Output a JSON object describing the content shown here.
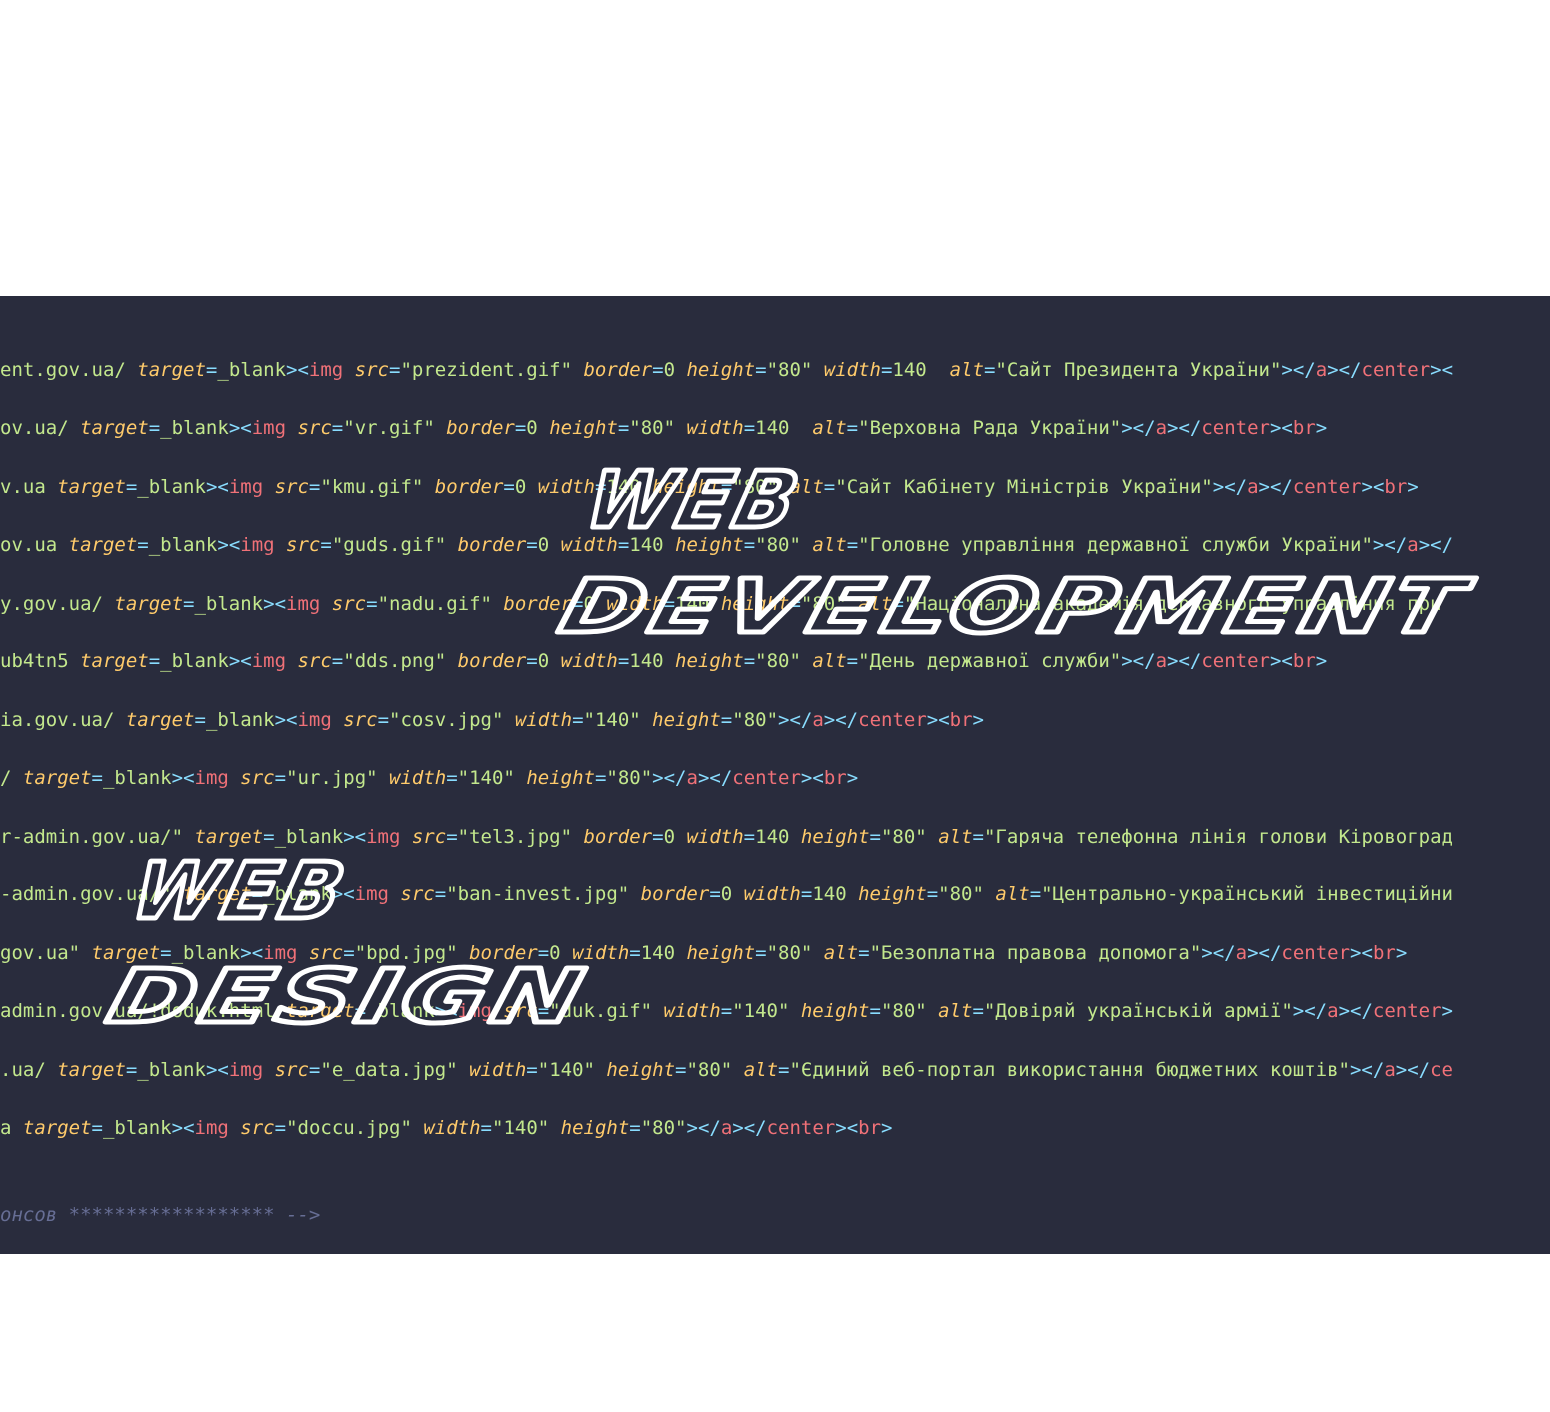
{
  "colors": {
    "background": "#ffffff",
    "editor_background": "#292c3d",
    "plain": "#c3e88d",
    "attribute": "#ffcb6b",
    "tag": "#f07178",
    "punctuation": "#89ddff",
    "comment": "#676e95",
    "logo_outline": "#ffffff"
  },
  "code_lines": [
    [
      [
        "p",
        "ent.gov.ua/ "
      ],
      [
        "a",
        "target"
      ],
      [
        "u",
        "="
      ],
      [
        "p",
        "_blank"
      ],
      [
        "u",
        "><"
      ],
      [
        "t",
        "img "
      ],
      [
        "a",
        "src"
      ],
      [
        "u",
        "="
      ],
      [
        "p",
        "\"prezident.gif\" "
      ],
      [
        "a",
        "border"
      ],
      [
        "u",
        "="
      ],
      [
        "p",
        "0 "
      ],
      [
        "a",
        "height"
      ],
      [
        "u",
        "="
      ],
      [
        "p",
        "\"80\" "
      ],
      [
        "a",
        "width"
      ],
      [
        "u",
        "="
      ],
      [
        "p",
        "140  "
      ],
      [
        "a",
        "alt"
      ],
      [
        "u",
        "="
      ],
      [
        "p",
        "\"Сайт Президента України\""
      ],
      [
        "u",
        "></"
      ],
      [
        "t",
        "a"
      ],
      [
        "u",
        "></"
      ],
      [
        "t",
        "center"
      ],
      [
        "u",
        "><"
      ]
    ],
    [
      [
        "p",
        "ov.ua/ "
      ],
      [
        "a",
        "target"
      ],
      [
        "u",
        "="
      ],
      [
        "p",
        "_blank"
      ],
      [
        "u",
        "><"
      ],
      [
        "t",
        "img "
      ],
      [
        "a",
        "src"
      ],
      [
        "u",
        "="
      ],
      [
        "p",
        "\"vr.gif\" "
      ],
      [
        "a",
        "border"
      ],
      [
        "u",
        "="
      ],
      [
        "p",
        "0 "
      ],
      [
        "a",
        "height"
      ],
      [
        "u",
        "="
      ],
      [
        "p",
        "\"80\" "
      ],
      [
        "a",
        "width"
      ],
      [
        "u",
        "="
      ],
      [
        "p",
        "140  "
      ],
      [
        "a",
        "alt"
      ],
      [
        "u",
        "="
      ],
      [
        "p",
        "\"Верховна Рада України\""
      ],
      [
        "u",
        "></"
      ],
      [
        "t",
        "a"
      ],
      [
        "u",
        "></"
      ],
      [
        "t",
        "center"
      ],
      [
        "u",
        "><"
      ],
      [
        "t",
        "br"
      ],
      [
        "u",
        ">"
      ]
    ],
    [
      [
        "p",
        "v.ua "
      ],
      [
        "a",
        "target"
      ],
      [
        "u",
        "="
      ],
      [
        "p",
        "_blank"
      ],
      [
        "u",
        "><"
      ],
      [
        "t",
        "img "
      ],
      [
        "a",
        "src"
      ],
      [
        "u",
        "="
      ],
      [
        "p",
        "\"kmu.gif\" "
      ],
      [
        "a",
        "border"
      ],
      [
        "u",
        "="
      ],
      [
        "p",
        "0 "
      ],
      [
        "a",
        "width"
      ],
      [
        "u",
        "="
      ],
      [
        "p",
        "140 "
      ],
      [
        "a",
        "height"
      ],
      [
        "u",
        "="
      ],
      [
        "p",
        "\"80\" "
      ],
      [
        "a",
        "alt"
      ],
      [
        "u",
        "="
      ],
      [
        "p",
        "\"Сайт Кабінету Міністрів України\""
      ],
      [
        "u",
        "></"
      ],
      [
        "t",
        "a"
      ],
      [
        "u",
        "></"
      ],
      [
        "t",
        "center"
      ],
      [
        "u",
        "><"
      ],
      [
        "t",
        "br"
      ],
      [
        "u",
        ">"
      ]
    ],
    [
      [
        "p",
        "ov.ua "
      ],
      [
        "a",
        "target"
      ],
      [
        "u",
        "="
      ],
      [
        "p",
        "_blank"
      ],
      [
        "u",
        "><"
      ],
      [
        "t",
        "img "
      ],
      [
        "a",
        "src"
      ],
      [
        "u",
        "="
      ],
      [
        "p",
        "\"guds.gif\" "
      ],
      [
        "a",
        "border"
      ],
      [
        "u",
        "="
      ],
      [
        "p",
        "0 "
      ],
      [
        "a",
        "width"
      ],
      [
        "u",
        "="
      ],
      [
        "p",
        "140 "
      ],
      [
        "a",
        "height"
      ],
      [
        "u",
        "="
      ],
      [
        "p",
        "\"80\" "
      ],
      [
        "a",
        "alt"
      ],
      [
        "u",
        "="
      ],
      [
        "p",
        "\"Головне управління державної служби України\""
      ],
      [
        "u",
        "></"
      ],
      [
        "t",
        "a"
      ],
      [
        "u",
        "></"
      ]
    ],
    [
      [
        "p",
        "y.gov.ua/ "
      ],
      [
        "a",
        "target"
      ],
      [
        "u",
        "="
      ],
      [
        "p",
        "_blank"
      ],
      [
        "u",
        "><"
      ],
      [
        "t",
        "img "
      ],
      [
        "a",
        "src"
      ],
      [
        "u",
        "="
      ],
      [
        "p",
        "\"nadu.gif\" "
      ],
      [
        "a",
        "border"
      ],
      [
        "u",
        "="
      ],
      [
        "p",
        "0 "
      ],
      [
        "a",
        "width"
      ],
      [
        "u",
        "="
      ],
      [
        "p",
        "140 "
      ],
      [
        "a",
        "height"
      ],
      [
        "u",
        "="
      ],
      [
        "p",
        "\"80\" "
      ],
      [
        "a",
        "alt"
      ],
      [
        "u",
        "="
      ],
      [
        "p",
        "\"Національна академія державного управління при"
      ]
    ],
    [
      [
        "p",
        "ub4tn5 "
      ],
      [
        "a",
        "target"
      ],
      [
        "u",
        "="
      ],
      [
        "p",
        "_blank"
      ],
      [
        "u",
        "><"
      ],
      [
        "t",
        "img "
      ],
      [
        "a",
        "src"
      ],
      [
        "u",
        "="
      ],
      [
        "p",
        "\"dds.png\" "
      ],
      [
        "a",
        "border"
      ],
      [
        "u",
        "="
      ],
      [
        "p",
        "0 "
      ],
      [
        "a",
        "width"
      ],
      [
        "u",
        "="
      ],
      [
        "p",
        "140 "
      ],
      [
        "a",
        "height"
      ],
      [
        "u",
        "="
      ],
      [
        "p",
        "\"80\" "
      ],
      [
        "a",
        "alt"
      ],
      [
        "u",
        "="
      ],
      [
        "p",
        "\"День державної служби\""
      ],
      [
        "u",
        "></"
      ],
      [
        "t",
        "a"
      ],
      [
        "u",
        "></"
      ],
      [
        "t",
        "center"
      ],
      [
        "u",
        "><"
      ],
      [
        "t",
        "br"
      ],
      [
        "u",
        ">"
      ]
    ],
    [
      [
        "p",
        "ia.gov.ua/ "
      ],
      [
        "a",
        "target"
      ],
      [
        "u",
        "="
      ],
      [
        "p",
        "_blank"
      ],
      [
        "u",
        "><"
      ],
      [
        "t",
        "img "
      ],
      [
        "a",
        "src"
      ],
      [
        "u",
        "="
      ],
      [
        "p",
        "\"cosv.jpg\" "
      ],
      [
        "a",
        "width"
      ],
      [
        "u",
        "="
      ],
      [
        "p",
        "\"140\" "
      ],
      [
        "a",
        "height"
      ],
      [
        "u",
        "="
      ],
      [
        "p",
        "\"80\""
      ],
      [
        "u",
        "></"
      ],
      [
        "t",
        "a"
      ],
      [
        "u",
        "></"
      ],
      [
        "t",
        "center"
      ],
      [
        "u",
        "><"
      ],
      [
        "t",
        "br"
      ],
      [
        "u",
        ">"
      ]
    ],
    [
      [
        "p",
        "/ "
      ],
      [
        "a",
        "target"
      ],
      [
        "u",
        "="
      ],
      [
        "p",
        "_blank"
      ],
      [
        "u",
        "><"
      ],
      [
        "t",
        "img "
      ],
      [
        "a",
        "src"
      ],
      [
        "u",
        "="
      ],
      [
        "p",
        "\"ur.jpg\" "
      ],
      [
        "a",
        "width"
      ],
      [
        "u",
        "="
      ],
      [
        "p",
        "\"140\" "
      ],
      [
        "a",
        "height"
      ],
      [
        "u",
        "="
      ],
      [
        "p",
        "\"80\""
      ],
      [
        "u",
        "></"
      ],
      [
        "t",
        "a"
      ],
      [
        "u",
        "></"
      ],
      [
        "t",
        "center"
      ],
      [
        "u",
        "><"
      ],
      [
        "t",
        "br"
      ],
      [
        "u",
        ">"
      ]
    ],
    [
      [
        "p",
        "r-admin.gov.ua/\" "
      ],
      [
        "a",
        "target"
      ],
      [
        "u",
        "="
      ],
      [
        "p",
        "_blank"
      ],
      [
        "u",
        "><"
      ],
      [
        "t",
        "img "
      ],
      [
        "a",
        "src"
      ],
      [
        "u",
        "="
      ],
      [
        "p",
        "\"tel3.jpg\" "
      ],
      [
        "a",
        "border"
      ],
      [
        "u",
        "="
      ],
      [
        "p",
        "0 "
      ],
      [
        "a",
        "width"
      ],
      [
        "u",
        "="
      ],
      [
        "p",
        "140 "
      ],
      [
        "a",
        "height"
      ],
      [
        "u",
        "="
      ],
      [
        "p",
        "\"80\" "
      ],
      [
        "a",
        "alt"
      ],
      [
        "u",
        "="
      ],
      [
        "p",
        "\"Гаряча телефонна лінія голови Кіровоград"
      ]
    ],
    [
      [
        "p",
        "-admin.gov.ua/\" "
      ],
      [
        "a",
        "target"
      ],
      [
        "u",
        "="
      ],
      [
        "p",
        "_blank"
      ],
      [
        "u",
        "><"
      ],
      [
        "t",
        "img "
      ],
      [
        "a",
        "src"
      ],
      [
        "u",
        "="
      ],
      [
        "p",
        "\"ban-invest.jpg\" "
      ],
      [
        "a",
        "border"
      ],
      [
        "u",
        "="
      ],
      [
        "p",
        "0 "
      ],
      [
        "a",
        "width"
      ],
      [
        "u",
        "="
      ],
      [
        "p",
        "140 "
      ],
      [
        "a",
        "height"
      ],
      [
        "u",
        "="
      ],
      [
        "p",
        "\"80\" "
      ],
      [
        "a",
        "alt"
      ],
      [
        "u",
        "="
      ],
      [
        "p",
        "\"Центрально-український інвестиційни"
      ]
    ],
    [
      [
        "p",
        "gov.ua\" "
      ],
      [
        "a",
        "target"
      ],
      [
        "u",
        "="
      ],
      [
        "p",
        "_blank"
      ],
      [
        "u",
        "><"
      ],
      [
        "t",
        "img "
      ],
      [
        "a",
        "src"
      ],
      [
        "u",
        "="
      ],
      [
        "p",
        "\"bpd.jpg\" "
      ],
      [
        "a",
        "border"
      ],
      [
        "u",
        "="
      ],
      [
        "p",
        "0 "
      ],
      [
        "a",
        "width"
      ],
      [
        "u",
        "="
      ],
      [
        "p",
        "140 "
      ],
      [
        "a",
        "height"
      ],
      [
        "u",
        "="
      ],
      [
        "p",
        "\"80\" "
      ],
      [
        "a",
        "alt"
      ],
      [
        "u",
        "="
      ],
      [
        "p",
        "\"Безоплатна правова допомога\""
      ],
      [
        "u",
        "></"
      ],
      [
        "t",
        "a"
      ],
      [
        "u",
        "></"
      ],
      [
        "t",
        "center"
      ],
      [
        "u",
        "><"
      ],
      [
        "t",
        "br"
      ],
      [
        "u",
        ">"
      ]
    ],
    [
      [
        "p",
        "admin.gov.ua/!doduk.html "
      ],
      [
        "a",
        "target"
      ],
      [
        "u",
        "="
      ],
      [
        "p",
        "_blank"
      ],
      [
        "u",
        "><"
      ],
      [
        "t",
        "img "
      ],
      [
        "a",
        "src"
      ],
      [
        "u",
        "="
      ],
      [
        "p",
        "\"duk.gif\" "
      ],
      [
        "a",
        "width"
      ],
      [
        "u",
        "="
      ],
      [
        "p",
        "\"140\" "
      ],
      [
        "a",
        "height"
      ],
      [
        "u",
        "="
      ],
      [
        "p",
        "\"80\" "
      ],
      [
        "a",
        "alt"
      ],
      [
        "u",
        "="
      ],
      [
        "p",
        "\"Довіряй українській армії\""
      ],
      [
        "u",
        "></"
      ],
      [
        "t",
        "a"
      ],
      [
        "u",
        "></"
      ],
      [
        "t",
        "center"
      ],
      [
        "u",
        ">"
      ]
    ],
    [
      [
        "p",
        ".ua/ "
      ],
      [
        "a",
        "target"
      ],
      [
        "u",
        "="
      ],
      [
        "p",
        "_blank"
      ],
      [
        "u",
        "><"
      ],
      [
        "t",
        "img "
      ],
      [
        "a",
        "src"
      ],
      [
        "u",
        "="
      ],
      [
        "p",
        "\"e_data.jpg\" "
      ],
      [
        "a",
        "width"
      ],
      [
        "u",
        "="
      ],
      [
        "p",
        "\"140\" "
      ],
      [
        "a",
        "height"
      ],
      [
        "u",
        "="
      ],
      [
        "p",
        "\"80\" "
      ],
      [
        "a",
        "alt"
      ],
      [
        "u",
        "="
      ],
      [
        "p",
        "\"Єдиний веб-портал використання бюджетних коштів\""
      ],
      [
        "u",
        "></"
      ],
      [
        "t",
        "a"
      ],
      [
        "u",
        "></"
      ],
      [
        "t",
        "ce"
      ]
    ],
    [
      [
        "p",
        "a "
      ],
      [
        "a",
        "target"
      ],
      [
        "u",
        "="
      ],
      [
        "p",
        "_blank"
      ],
      [
        "u",
        "><"
      ],
      [
        "t",
        "img "
      ],
      [
        "a",
        "src"
      ],
      [
        "u",
        "="
      ],
      [
        "p",
        "\"doccu.jpg\" "
      ],
      [
        "a",
        "width"
      ],
      [
        "u",
        "="
      ],
      [
        "p",
        "\"140\" "
      ],
      [
        "a",
        "height"
      ],
      [
        "u",
        "="
      ],
      [
        "p",
        "\"80\""
      ],
      [
        "u",
        "></"
      ],
      [
        "t",
        "a"
      ],
      [
        "u",
        "></"
      ],
      [
        "t",
        "center"
      ],
      [
        "u",
        "><"
      ],
      [
        "t",
        "br"
      ],
      [
        "u",
        ">"
      ]
    ],
    [
      [
        "c",
        "онсов ****************** -->"
      ]
    ]
  ],
  "overlay": {
    "development_line1": "WEB",
    "development_line2": "DEVELOPMENT",
    "design_line1": "WEB",
    "design_line2": "DESIGN"
  }
}
